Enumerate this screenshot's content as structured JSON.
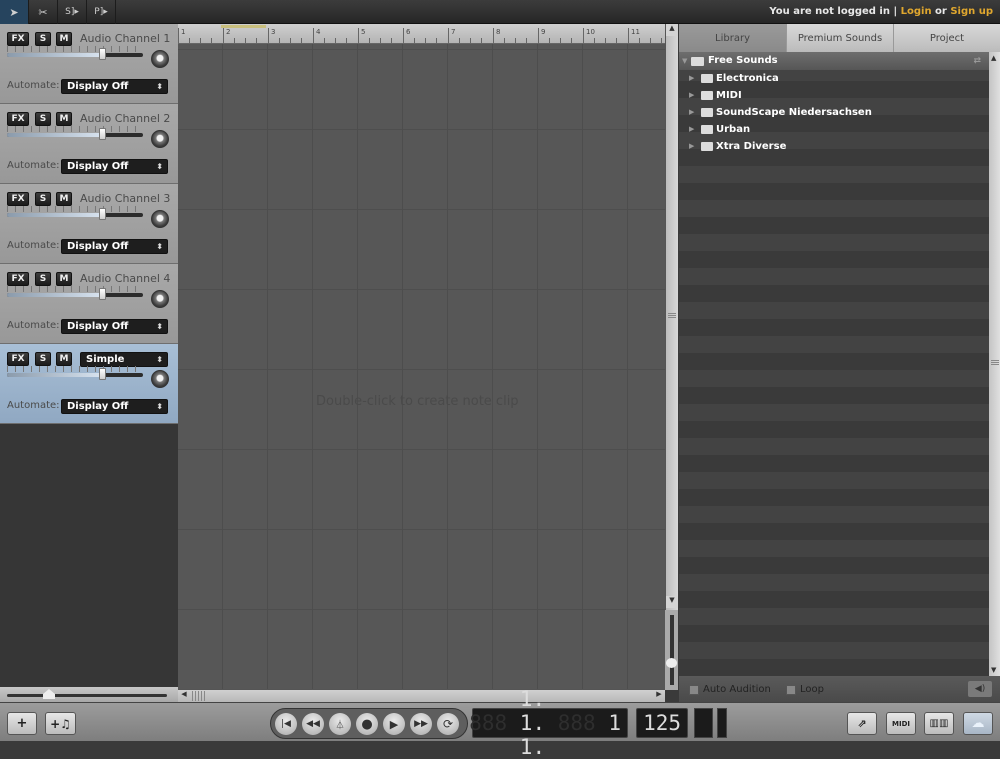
{
  "toolbar": {
    "tools": [
      {
        "name": "pointer-tool",
        "glyph": "➤",
        "active": true
      },
      {
        "name": "split-tool",
        "glyph": "✂",
        "active": false
      },
      {
        "name": "select-tool",
        "glyph": "S]▸",
        "active": false
      },
      {
        "name": "paste-tool",
        "glyph": "P]▸",
        "active": false
      }
    ]
  },
  "auth": {
    "status": "You are not logged in",
    "sep": " | ",
    "login": "Login",
    "or": " or ",
    "signup": "Sign up"
  },
  "tracks": [
    {
      "name": "Audio Channel 1",
      "volume": 0.7,
      "automate_label": "Automate:",
      "automate": "Display Off"
    },
    {
      "name": "Audio Channel 2",
      "volume": 0.7,
      "automate_label": "Automate:",
      "automate": "Display Off"
    },
    {
      "name": "Audio Channel 3",
      "volume": 0.7,
      "automate_label": "Automate:",
      "automate": "Display Off"
    },
    {
      "name": "Audio Channel 4",
      "volume": 0.7,
      "automate_label": "Automate:",
      "automate": "Display Off"
    },
    {
      "name": "Simple",
      "volume": 0.7,
      "automate_label": "Automate:",
      "automate": "Display Off",
      "selected": true
    }
  ],
  "track_buttons": {
    "fx": "FX",
    "solo": "S",
    "mute": "M"
  },
  "ruler": {
    "bars": [
      "1",
      "2",
      "3",
      "4",
      "5",
      "6",
      "7",
      "8",
      "9",
      "10",
      "11"
    ]
  },
  "arrange": {
    "hint": "Double-click to create note clip"
  },
  "panel": {
    "tabs": [
      "Library",
      "Premium Sounds",
      "Project"
    ],
    "active_tab": "Library",
    "root": "Free Sounds",
    "folders": [
      "Electronica",
      "MIDI",
      "SoundScape Niedersachsen",
      "Urban",
      "Xtra Diverse"
    ],
    "auto_audition": "Auto Audition",
    "loop": "Loop"
  },
  "transport": {
    "position_ghost": "888",
    "position": "1. 1. 1.",
    "ticks_ghost": "888",
    "ticks": "1",
    "tempo": "125"
  },
  "bottom": {
    "add_track": "+",
    "add_instrument": "+♫"
  }
}
